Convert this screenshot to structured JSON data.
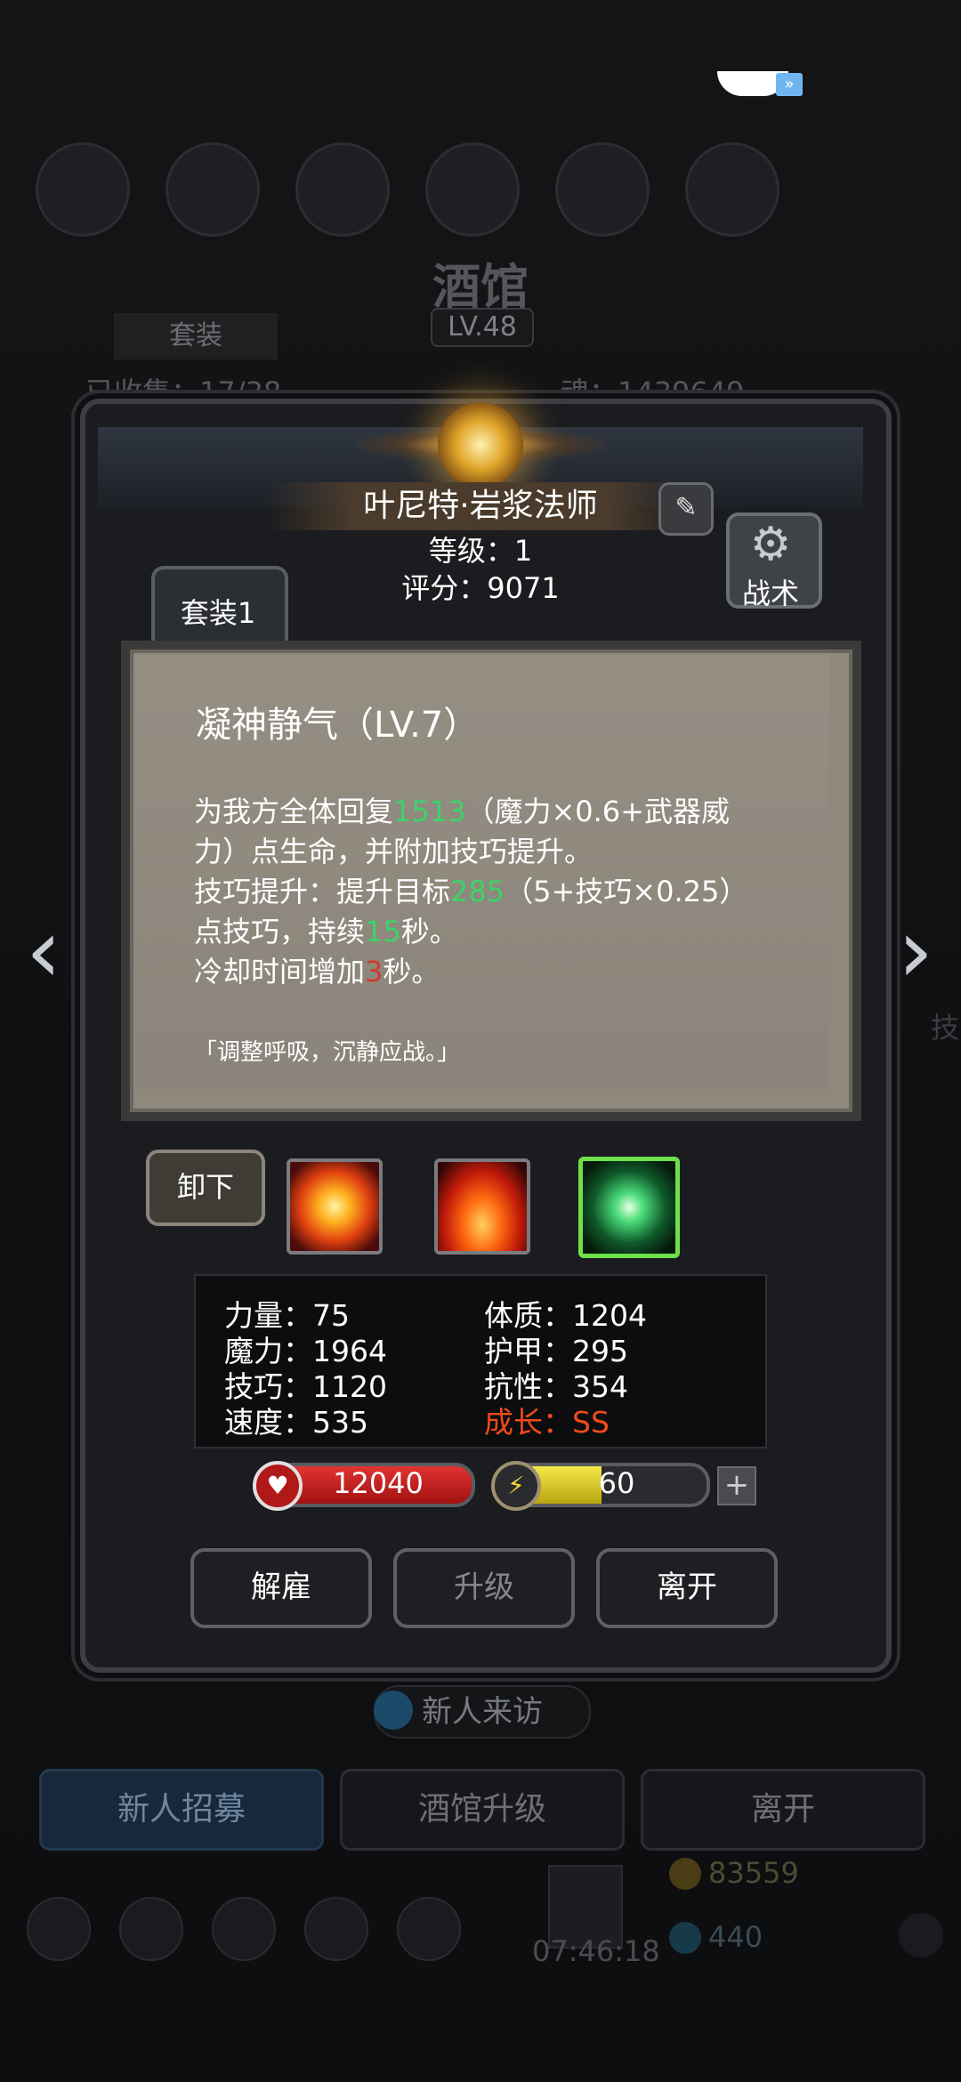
{
  "background": {
    "title": "酒馆",
    "level": "LV.48",
    "tab_label": "套装",
    "stat_left": "已收集：17/38",
    "stat_right": "魂：1439649",
    "visitor_label": "新人来访",
    "buttons": [
      {
        "label": "新人招募"
      },
      {
        "label": "酒馆升级"
      },
      {
        "label": "离开"
      }
    ],
    "timer": "07:46:18",
    "gold": "83559",
    "gems": "440",
    "side_label": "技"
  },
  "hero": {
    "name": "叶尼特·岩浆法师",
    "level_line": "等级：1",
    "score_line": "评分：9071",
    "tactic_label": "战术",
    "set_tab": "套装1"
  },
  "skill": {
    "title": "凝神静气（LV.7）",
    "desc_1a": "为我方全体回复",
    "heal_value": "1513",
    "desc_1b": "（魔力×0.6+武器威力）点生命，并附加技巧提升。",
    "desc_2a": "技巧提升：提升目标",
    "skill_value": "285",
    "desc_2b": "（5+技巧×0.25）点技巧，持续",
    "duration": "15",
    "desc_2c": "秒。",
    "desc_3a": "冷却时间增加",
    "cooldown": "3",
    "desc_3b": "秒。",
    "quote": "「调整呼吸，沉静应战。」"
  },
  "slots": {
    "unequip_label": "卸下",
    "icons": [
      "fire-burst-icon",
      "flame-icon",
      "green-crystal-icon"
    ],
    "selected_index": 2
  },
  "stats": {
    "strength": "力量：75",
    "magic": "魔力：1964",
    "skill": "技巧：1120",
    "speed": "速度：535",
    "constitution": "体质：1204",
    "armor": "护甲：295",
    "resistance": "抗性：354",
    "growth": "成长：SS"
  },
  "bars": {
    "hp": "12040",
    "energy": "60",
    "energy_fill_fraction": 0.5,
    "plus": "+"
  },
  "actions": {
    "dismiss": "解雇",
    "upgrade": "升级",
    "leave": "离开"
  },
  "colors": {
    "highlight_green": "#3dd36a",
    "highlight_red": "#d23a2a",
    "growth_orange": "#f04a1a",
    "tooltip_bg": "#8e887d"
  },
  "nav": {
    "left_arrow": "‹",
    "right_arrow": "›"
  }
}
